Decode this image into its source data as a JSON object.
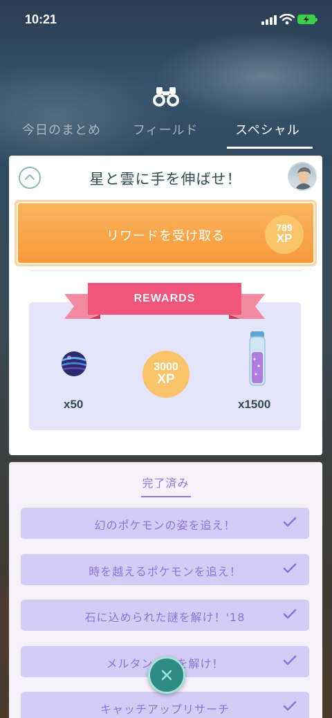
{
  "status_bar": {
    "time": "10:21"
  },
  "tabs": [
    {
      "label": "今日のまとめ"
    },
    {
      "label": "フィールド"
    },
    {
      "label": "スペシャル"
    }
  ],
  "card": {
    "title": "星と雲に手を伸ばせ！",
    "claim_button": {
      "label": "リワードを受け取る",
      "xp_value": "789",
      "xp_unit": "XP"
    },
    "rewards_banner": "REWARDS",
    "rewards": [
      {
        "icon": "great-ball-icon",
        "count": "x50"
      },
      {
        "icon": "xp-icon",
        "value": "3000",
        "unit": "XP"
      },
      {
        "icon": "stardust-vial-icon",
        "count": "x1500"
      }
    ]
  },
  "completed": {
    "title": "完了済み",
    "items": [
      {
        "label": "幻のポケモンの姿を追え！"
      },
      {
        "label": "時を越えるポケモンを追え！"
      },
      {
        "label": "石に込められた謎を解け！'18"
      },
      {
        "label": "メルタン　　を解け！"
      },
      {
        "label": "キャッチアップリサーチ"
      }
    ]
  },
  "colors": {
    "accent": "#8a78e0",
    "claim_orange": "#f79a3c",
    "ribbon_pink": "#f0567a",
    "close_teal": "#2e8a84"
  }
}
